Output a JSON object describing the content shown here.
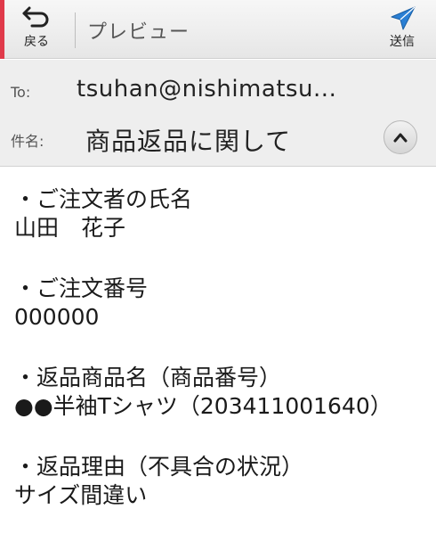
{
  "toolbar": {
    "back_label": "戻る",
    "title": "プレビュー",
    "send_label": "送信"
  },
  "header": {
    "to_label": "To:",
    "to_value": "tsuhan@nishimatsu...",
    "subject_label": "件名:",
    "subject_value": "商品返品に関して"
  },
  "body": {
    "sections": [
      {
        "heading": "・ご注文者の氏名",
        "value": "山田　花子"
      },
      {
        "heading": "・ご注文番号",
        "value": "000000"
      },
      {
        "heading": "・返品商品名（商品番号）",
        "value": "●●半袖Tシャツ（203411001640）"
      },
      {
        "heading": "・返品理由（不具合の状況）",
        "value": "サイズ間違い"
      }
    ]
  },
  "colors": {
    "accent_bar": "#e03a4a",
    "send_icon": "#2a7fd4"
  },
  "icons": {
    "back": "back-arrow-icon",
    "send": "send-arrow-icon",
    "collapse": "chevron-up-icon"
  }
}
